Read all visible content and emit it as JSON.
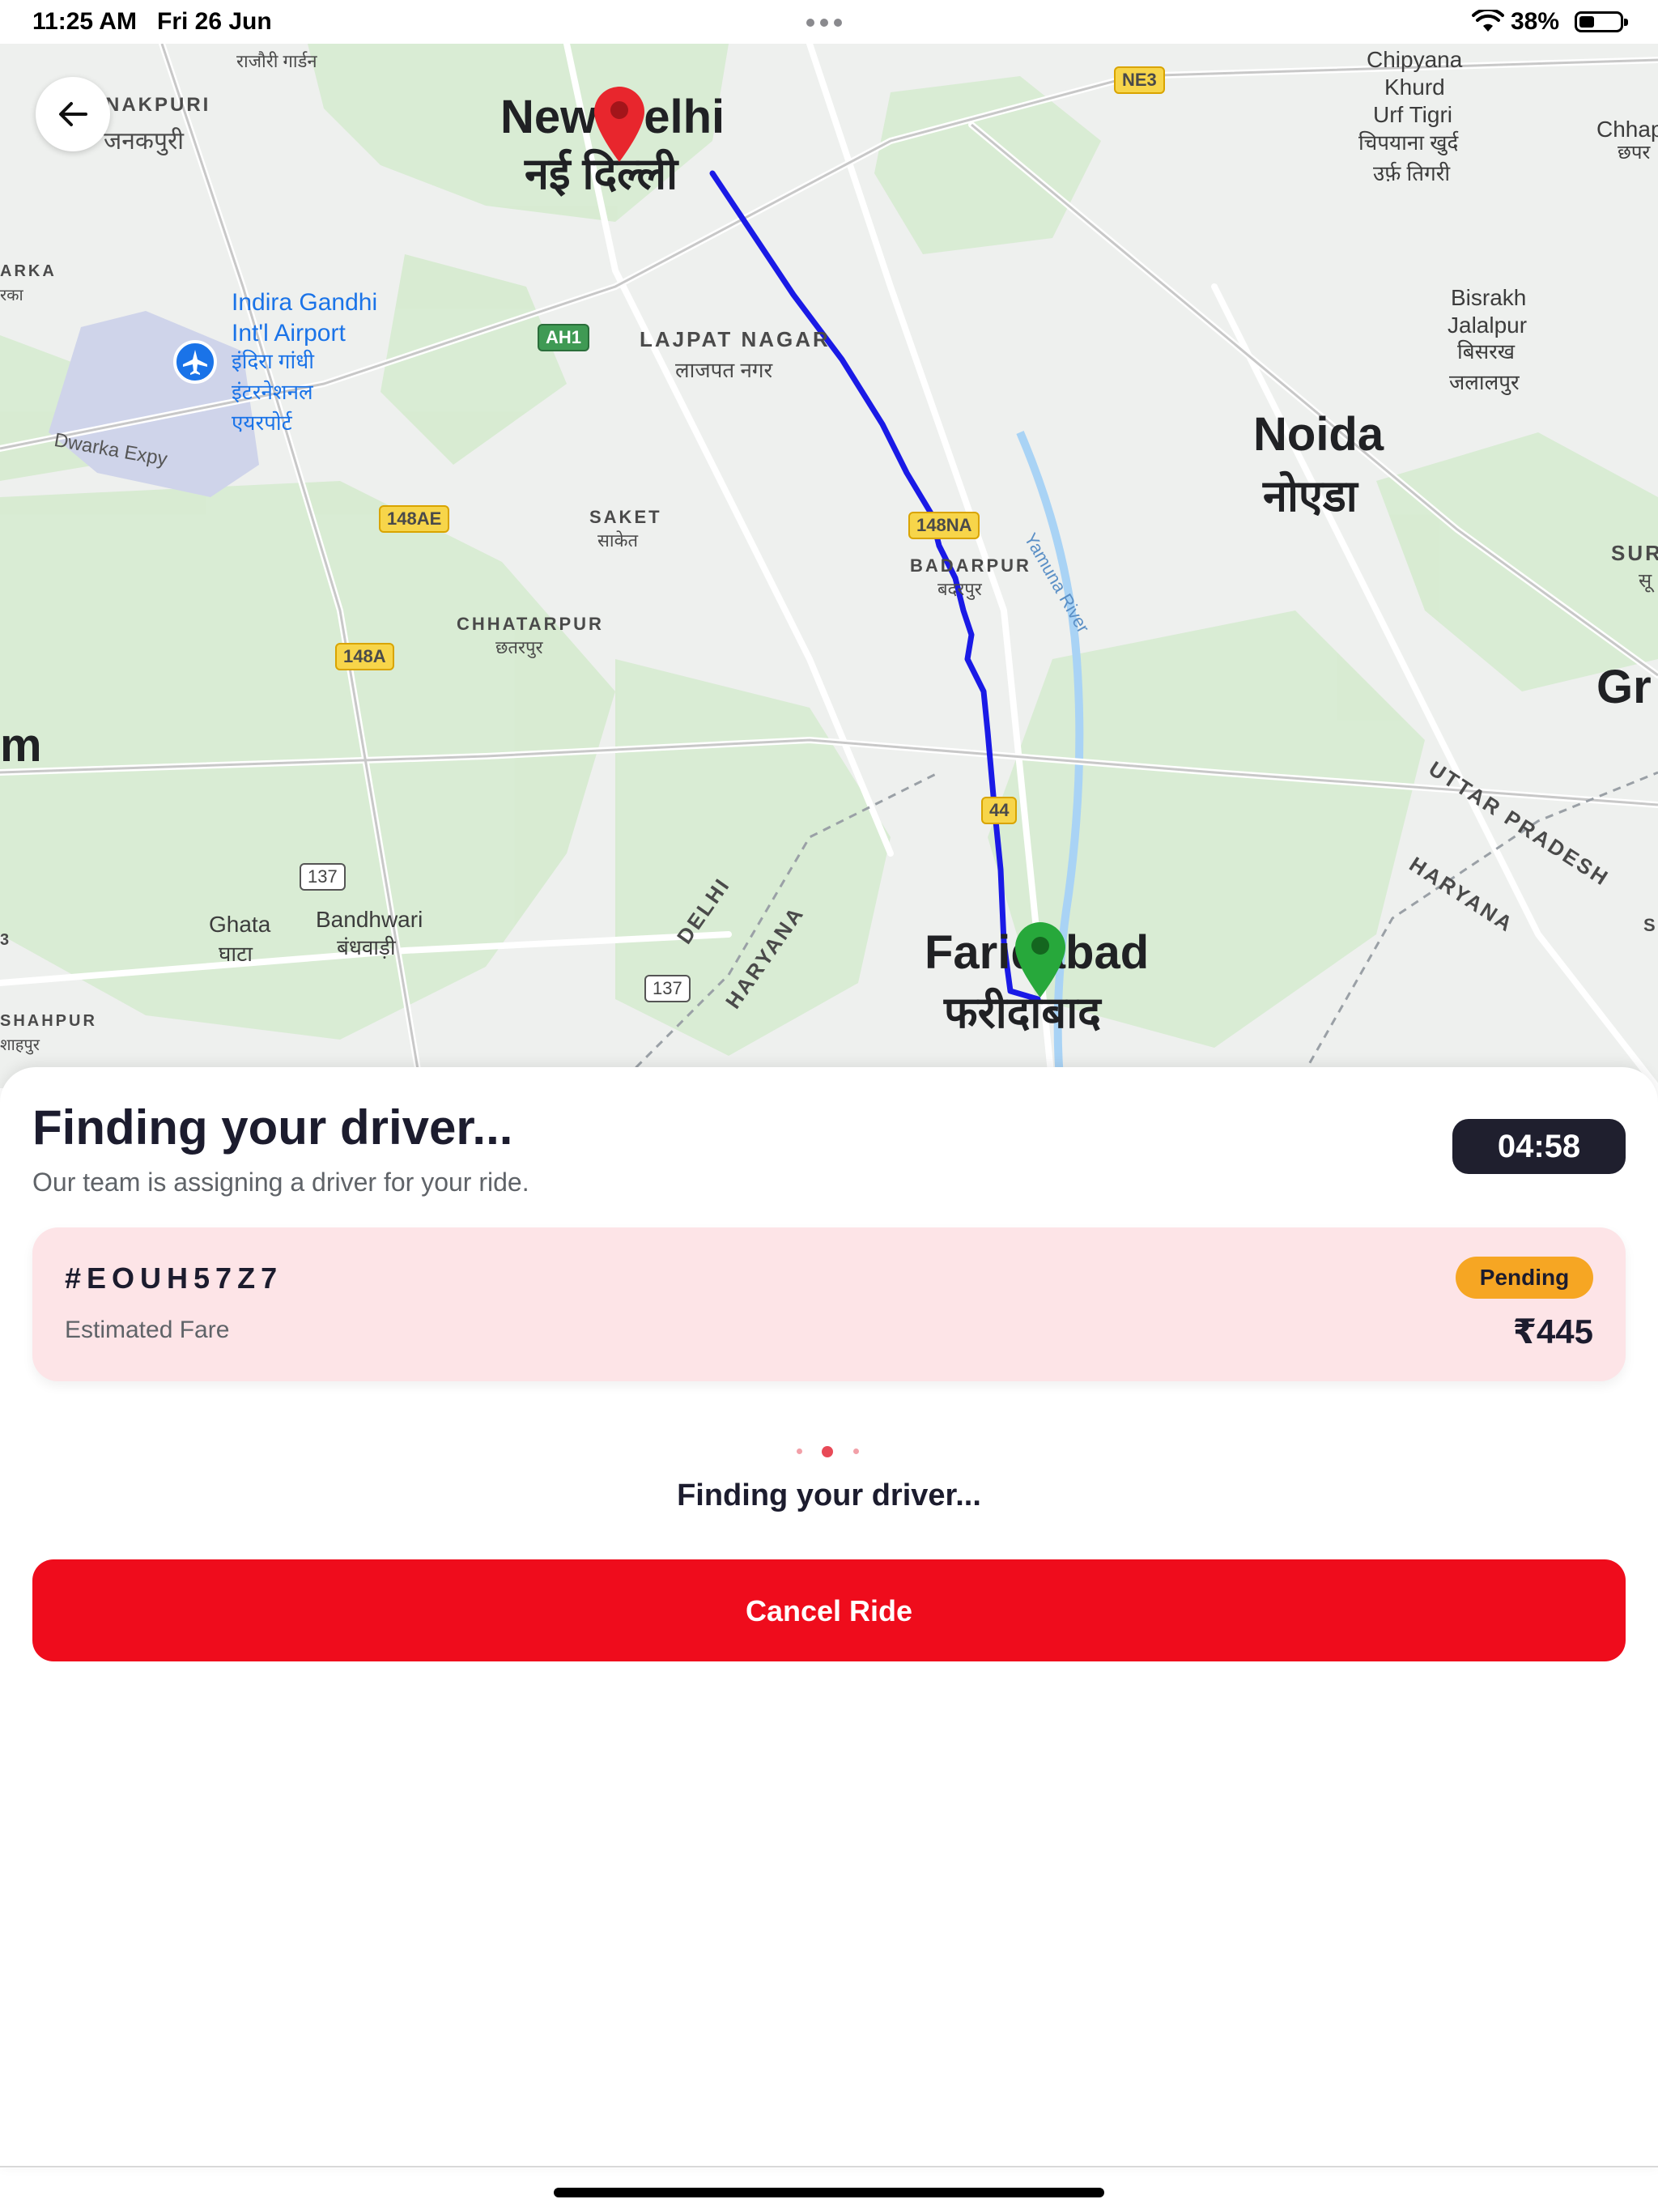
{
  "status_bar": {
    "time": "11:25 AM",
    "date": "Fri 26 Jun",
    "battery": "38%",
    "battery_level": 0.38,
    "icons": [
      "wifi-icon",
      "battery-icon",
      "more-dots-icon"
    ]
  },
  "map": {
    "labels": {
      "rajouri": "राजौरी गार्डन",
      "janakpuri_en": "NAKPURI",
      "janakpuri_hi": "जनकपुरी",
      "new_delhi_en": "New Delhi",
      "new_delhi_hi": "नई दिल्ली",
      "airport_en1": "Indira Gandhi",
      "airport_en2": "Int'l Airport",
      "airport_hi1": "इंदिरा गांधी",
      "airport_hi2": "इंटरनेशनल",
      "airport_hi3": "एयरपोर्ट",
      "dwarka_road": "Dwarka Expy",
      "arka": "ARKA",
      "arka_hi": "रका",
      "lajpat_en": "LAJPAT NAGAR",
      "lajpat_hi": "लाजपत नगर",
      "saket_en": "SAKET",
      "saket_hi": "साकेत",
      "chhatarpur_en": "CHHATARPUR",
      "chhatarpur_hi": "छतरपुर",
      "badarpur_en": "BADARPUR",
      "badarpur_hi": "बदरपुर",
      "chipyana1": "Chipyana",
      "chipyana2": "Khurd",
      "chipyana3": "Urf Tigri",
      "chipyana_hi1": "चिपयाना खुर्द",
      "chipyana_hi2": "उर्फ़ तिगरी",
      "chhap": "Chhap",
      "chhap_hi": "छपर",
      "bisrakh1": "Bisrakh",
      "bisrakh2": "Jalalpur",
      "bisrakh_hi1": "बिसरख",
      "bisrakh_hi2": "जलालपुर",
      "noida_en": "Noida",
      "noida_hi": "नोएडा",
      "yamuna": "Yamuna River",
      "sur": "SUR",
      "sur_hi": "सू",
      "gr": "Gr",
      "m": "m",
      "ghata_en": "Ghata",
      "ghata_hi": "घाटा",
      "bandhwari_en": "Bandhwari",
      "bandhwari_hi": "बंधवाड़ी",
      "delhi_border": "DELHI",
      "haryana_border": "HARYANA",
      "up_border": "UTTAR PRADESH",
      "haryana_border2": "HARYANA",
      "faridabad_en": "Faridabad",
      "faridabad_hi": "फरीदाबाद",
      "shahpur_en": "SHAHPUR",
      "shahpur_hi": "शाहपुर",
      "s_edge": "S",
      "three_edge": "3"
    },
    "shields": {
      "ne3": "NE3",
      "ah1": "AH1",
      "r148ae": "148AE",
      "r148na": "148NA",
      "r148a": "148A",
      "r44": "44",
      "r137a": "137",
      "r137b": "137"
    },
    "markers": {
      "pickup_color": "#e8262d",
      "drop_color": "#27a83b",
      "route_color": "#1a1ae6"
    }
  },
  "ride": {
    "title": "Finding your driver...",
    "subtitle": "Our team is assigning a driver for your ride.",
    "timer": "04:58",
    "ride_id": "#EOUH57Z7",
    "status": "Pending",
    "fare_label": "Estimated Fare",
    "fare": "₹445",
    "finding_text": "Finding your driver...",
    "cancel_label": "Cancel Ride"
  },
  "colors": {
    "accent": "#ef0c1c",
    "card_bg": "#fde4e7",
    "badge": "#f6a623",
    "timer_bg": "#1f1f2e"
  }
}
